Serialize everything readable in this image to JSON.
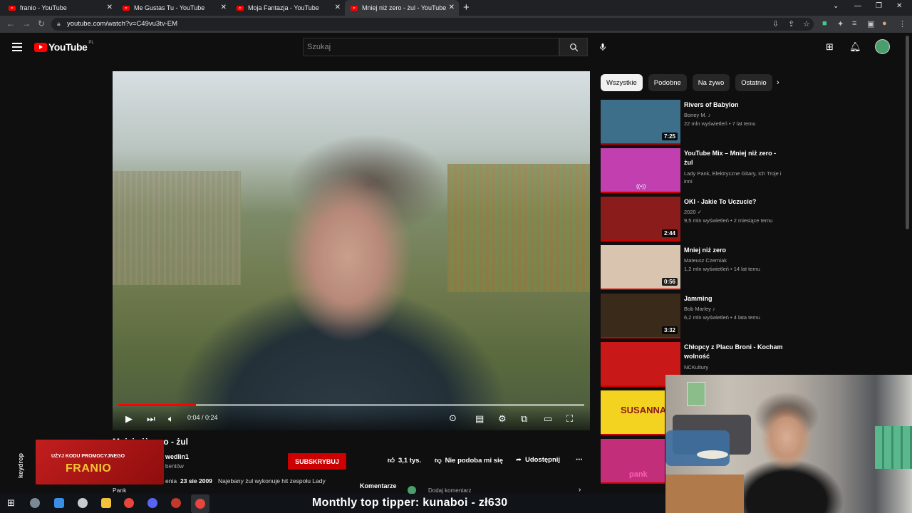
{
  "browser": {
    "tabs": [
      {
        "title": "franio - YouTube"
      },
      {
        "title": "Me Gustas Tu - YouTube"
      },
      {
        "title": "Moja Fantazja - YouTube"
      },
      {
        "title": "Mniej niż zero - żul - YouTube"
      }
    ],
    "url": "youtube.com/watch?v=C49vu3tv-EM"
  },
  "yt": {
    "logo_text": "YouTube",
    "country": "PL",
    "search_placeholder": "Szukaj"
  },
  "player": {
    "time": "0:04 / 0:24",
    "progress_fraction": 0.167
  },
  "video": {
    "title": "Mniej niż zero - żul",
    "channel_name": "wedlin1",
    "channel_subs": "bentów",
    "subscribe_label": "SUBSKRYBUJ",
    "likes": "3,1 tys.",
    "dislike_label": "Nie podoba mi się",
    "share_label": "Udostępnij",
    "desc_prefix": "enia",
    "date": "23 sie 2009",
    "desc": "Najebany żul wykonuje hit zespołu Lady",
    "desc_line2": "Pank",
    "comments_label": "Komentarze",
    "add_comment_placeholder": "Dodaj komentarz"
  },
  "chips": [
    "Wszystkie",
    "Podobne",
    "Na żywo",
    "Ostatnio"
  ],
  "recommendations": [
    {
      "title": "Rivers of Babylon",
      "channel": "Boney M. ♪",
      "meta": "22 mln wyświetleń • 7 lat temu",
      "duration": "7:25",
      "thumb_color": "#3d6f8a"
    },
    {
      "title": "YouTube Mix – Mniej niż zero - żul",
      "channel": "Lady Pank, Elektryczne Gitary, Ich Troje i inni",
      "meta": "",
      "duration": "",
      "mix": "((•))",
      "thumb_color": "#c23fb0"
    },
    {
      "title": "OKI - Jakie To Uczucie?",
      "channel": "2020 ✓",
      "meta": "9,5 mln wyświetleń • 2 miesiące temu",
      "duration": "2:44",
      "thumb_color": "#8a1c1c"
    },
    {
      "title": "Mniej niż zero",
      "channel": "Mateusz Czerniak",
      "meta": "1,2 mln wyświetleń • 14 lat temu",
      "duration": "0:56",
      "thumb_color": "#d9c4b0"
    },
    {
      "title": "Jamming",
      "channel": "Bob Marley ♪",
      "meta": "6,2 mln wyświetleń • 4 lata temu",
      "duration": "3:32",
      "thumb_color": "#3a2a1a"
    },
    {
      "title": "Chłopcy z Placu Broni - Kocham wolność",
      "channel": "NCKultury",
      "meta": "",
      "duration": "",
      "thumb_color": "#c81818"
    },
    {
      "title": "",
      "channel": "",
      "meta": "",
      "duration": "",
      "thumb_color": "#f3d320",
      "thumb_text": "SUSANNA"
    },
    {
      "title": "",
      "channel": "",
      "meta": "",
      "duration": "",
      "thumb_color": "#c22e7a",
      "thumb_text": "pank"
    }
  ],
  "promo": {
    "top_text": "UŻYJ KODU PROMOCYJNEGO",
    "code": "FRANIO",
    "brand": "keydrop"
  },
  "stream": {
    "tipper_text": "Monthly top tipper: kunaboi - zł630"
  }
}
